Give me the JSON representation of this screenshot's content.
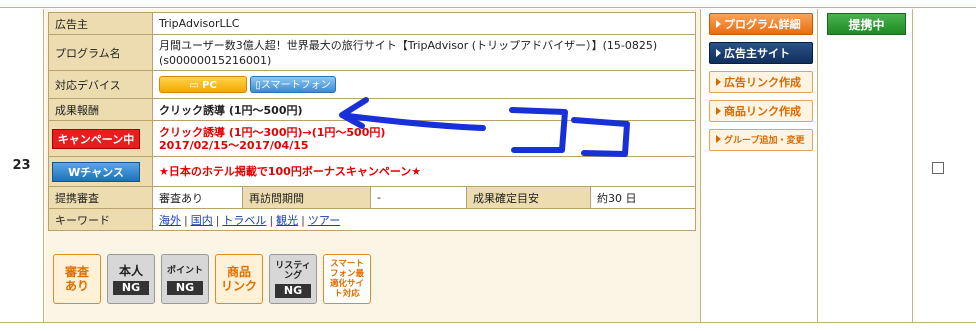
{
  "row": {
    "number": "23",
    "labels": {
      "advertiser": "広告主",
      "program_name": "プログラム名",
      "devices": "対応デバイス",
      "reward": "成果報酬",
      "review": "提携審査",
      "revisit_period": "再訪問期間",
      "confirm_estimate": "成果確定目安",
      "keywords": "キーワード"
    },
    "advertiser": "TripAdvisorLLC",
    "program_name_line1": "月間ユーザー数3億人超！世界最大の旅行サイト【TripAdvisor (トリップアドバイザー）】(15-0825)",
    "program_name_line2": "(s00000015216001)",
    "device_pc": "PC",
    "device_sp": "スマートフォン",
    "reward_value": "クリック誘導 (1円〜500円)",
    "campaign_label": "キャンペーン中",
    "campaign_text1": "クリック誘導 (1円〜300円)→(1円〜500円)",
    "campaign_text2": "2017/02/15〜2017/04/15",
    "w_chance_label": "Wチャンス",
    "w_chance_text": "★日本のホテル掲載で100円ボーナスキャンペーン★",
    "review_value": "審査あり",
    "revisit_value": "-",
    "confirm_value": "約30 日",
    "keywords": [
      "海外",
      "国内",
      "トラベル",
      "観光",
      "ツアー"
    ],
    "badges": [
      {
        "top": "審査",
        "bottom": "あり",
        "style": "orange",
        "ng": false
      },
      {
        "top": "本人",
        "bottom": "NG",
        "style": "gray",
        "ng": true
      },
      {
        "top": "ポイント",
        "bottom": "NG",
        "style": "gray",
        "ng": true
      },
      {
        "top": "商品",
        "bottom": "リンク",
        "style": "orange",
        "ng": false
      },
      {
        "top": "リスティング",
        "bottom": "NG",
        "style": "gray",
        "ng": true
      },
      {
        "top": "スマートフォン最適化サイト対応",
        "bottom": "",
        "style": "sp",
        "ng": false
      }
    ]
  },
  "side_buttons": {
    "program_detail": "プログラム詳細",
    "advertiser_site": "広告主サイト",
    "ad_link": "広告リンク作成",
    "product_link": "商品リンク作成",
    "group_add": "グループ追加・変更"
  },
  "status_label": "提携中",
  "annotation_text": "ココ",
  "colors": {
    "label_bg": "#eddcb0",
    "border": "#b9a26d",
    "campaign_red": "#e40000",
    "annotation_blue": "#1830d8",
    "status_green": "#1e8a22"
  }
}
